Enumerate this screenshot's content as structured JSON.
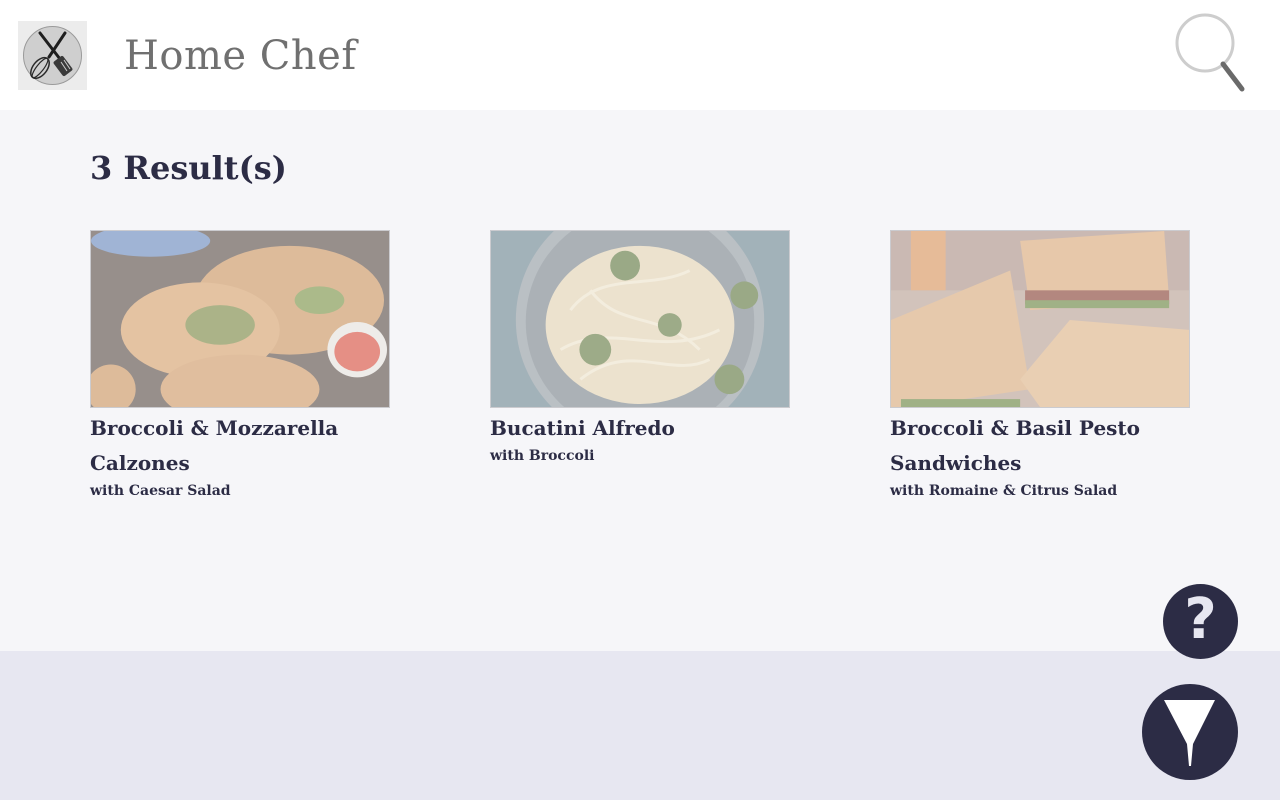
{
  "header": {
    "app_title": "Home Chef",
    "logo_icon": "crossed-whisk-spatula-icon",
    "search_icon": "magnifier-icon"
  },
  "results": {
    "count_label": "3 Result(s)",
    "items": [
      {
        "title": "Broccoli & Mozzarella Calzones",
        "subtitle": "with Caesar Salad"
      },
      {
        "title": "Bucatini Alfredo",
        "subtitle": "with Broccoli"
      },
      {
        "title": "Broccoli & Basil Pesto Sandwiches",
        "subtitle": "with Romaine & Citrus Salad"
      }
    ]
  },
  "fab": {
    "help_label": "?",
    "help_icon": "question-mark-icon",
    "filter_icon": "funnel-icon"
  },
  "colors": {
    "accent": "#2c2c45",
    "header_bg": "#ffffff",
    "content_bg": "#f6f6f9",
    "footer_bg": "#e7e7f1",
    "title_gray": "#707070"
  }
}
